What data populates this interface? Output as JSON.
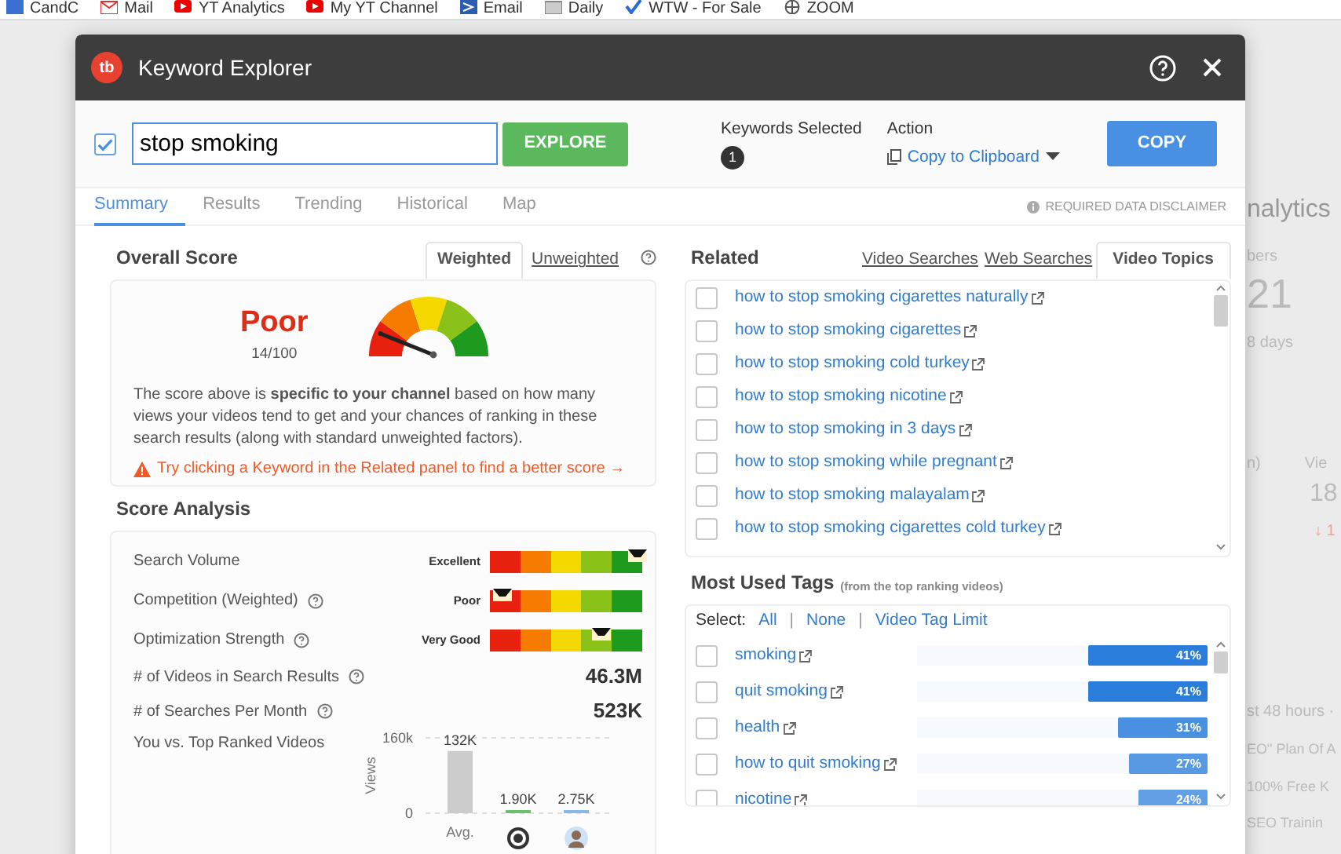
{
  "bookmarks": [
    {
      "label": "CandC",
      "kind": "grid"
    },
    {
      "label": "Mail",
      "kind": "mail"
    },
    {
      "label": "YT Analytics",
      "kind": "play"
    },
    {
      "label": "My YT Channel",
      "kind": "play"
    },
    {
      "label": "Email",
      "kind": "arrow"
    },
    {
      "label": "Daily",
      "kind": "folder"
    },
    {
      "label": "WTW - For Sale",
      "kind": "check"
    },
    {
      "label": "ZOOM",
      "kind": "globe"
    }
  ],
  "background": [
    {
      "kind": "heading",
      "text": "nalytics"
    },
    {
      "kind": "label",
      "text": "bers"
    },
    {
      "kind": "number",
      "text": "21"
    },
    {
      "kind": "label",
      "text": "8 days"
    },
    {
      "kind": "columns",
      "text": "n)",
      "second": "Vie"
    },
    {
      "kind": "number-right",
      "text": "18"
    },
    {
      "kind": "trend",
      "text": "↓ 1"
    },
    {
      "kind": "note",
      "text": "st 48 hours ·"
    },
    {
      "kind": "item",
      "text": "EO\" Plan Of A"
    },
    {
      "kind": "item",
      "text": "100% Free K"
    },
    {
      "kind": "item",
      "text": "SEO Trainin"
    }
  ],
  "dialog": {
    "logo": "tb",
    "title": "Keyword Explorer"
  },
  "search": {
    "checked": true,
    "value": "stop smoking",
    "button": "EXPLORE"
  },
  "keywords_selected": {
    "label": "Keywords Selected",
    "count": "1"
  },
  "action": {
    "label": "Action",
    "value": "Copy to Clipboard",
    "button": "COPY"
  },
  "tabs": [
    {
      "label": "Summary",
      "selected": true
    },
    {
      "label": "Results",
      "selected": false
    },
    {
      "label": "Trending",
      "selected": false
    },
    {
      "label": "Historical",
      "selected": false
    },
    {
      "label": "Map",
      "selected": false
    }
  ],
  "disclaimer": "REQUIRED DATA DISCLAIMER",
  "overall_score": {
    "title": "Overall Score",
    "tabs": [
      {
        "label": "Weighted",
        "selected": true
      },
      {
        "label": "Unweighted",
        "selected": false
      }
    ],
    "rating": "Poor",
    "score": "14/100",
    "gauge": {
      "level": 0.14
    },
    "description": "The score above is **specific to your channel** based on how many views your videos tend to get and your chances of ranking in these search results (along with standard unweighted factors).",
    "tip": "Try clicking a Keyword in the Related panel to find a better score →"
  },
  "score_analysis": {
    "title": "Score Analysis",
    "rows": [
      {
        "kind": "meter",
        "label": "Search Volume",
        "help": false,
        "rating": "Excellent",
        "level": 0.95
      },
      {
        "kind": "meter",
        "label": "Competition (Weighted)",
        "help": true,
        "rating": "Poor",
        "level": 0.06
      },
      {
        "kind": "meter",
        "label": "Optimization Strength",
        "help": true,
        "rating": "Very Good",
        "level": 0.71
      },
      {
        "kind": "stat",
        "label": "# of Videos in Search Results",
        "help": true,
        "value": "46.3M"
      },
      {
        "kind": "stat",
        "label": "# of Searches Per Month",
        "help": true,
        "value": "523K"
      },
      {
        "kind": "chart",
        "label": "You vs. Top Ranked Videos",
        "help": false,
        "bars": [
          {
            "kind": "text",
            "label": "Avg.",
            "color": "#cccccc"
          },
          {
            "kind": "target",
            "color": "#6cc070"
          },
          {
            "kind": "avatar",
            "color": "#8ab8e8"
          }
        ],
        "chart_data": {
          "type": "bar",
          "ylabel": "Views",
          "ylim": [
            0,
            160000
          ],
          "yticks": [
            {
              "value": 0,
              "label": "0"
            },
            {
              "value": 160000,
              "label": "160k"
            }
          ],
          "series": [
            {
              "values": [
                132000,
                1900,
                2750
              ]
            }
          ],
          "value_labels": [
            "132K",
            "1.90K",
            "2.75K"
          ]
        }
      }
    ]
  },
  "related": {
    "title": "Related",
    "tabs": [
      {
        "label": "Video Searches",
        "selected": false
      },
      {
        "label": "Web Searches",
        "selected": false
      },
      {
        "label": "Video Topics",
        "selected": true
      }
    ],
    "items": [
      {
        "label": "how to stop smoking cigarettes naturally",
        "checked": false
      },
      {
        "label": "how to stop smoking cigarettes",
        "checked": false
      },
      {
        "label": "how to stop smoking cold turkey",
        "checked": false
      },
      {
        "label": "how to stop smoking nicotine",
        "checked": false
      },
      {
        "label": "how to stop smoking in 3 days",
        "checked": false
      },
      {
        "label": "how to stop smoking while pregnant",
        "checked": false
      },
      {
        "label": "how to stop smoking malayalam",
        "checked": false
      },
      {
        "label": "how to stop smoking cigarettes cold turkey",
        "checked": false
      }
    ]
  },
  "tags": {
    "title": "Most Used Tags",
    "note": "(from the top ranking videos)",
    "select_label": "Select:",
    "links": [
      "All",
      "None",
      "Video Tag Limit"
    ],
    "separator": "|",
    "items": [
      {
        "label": "smoking",
        "checked": false,
        "level": 0.41,
        "reading": "41%"
      },
      {
        "label": "quit smoking",
        "checked": false,
        "level": 0.41,
        "reading": "41%"
      },
      {
        "label": "health",
        "checked": false,
        "level": 0.31,
        "reading": "31%"
      },
      {
        "label": "how to quit smoking",
        "checked": false,
        "level": 0.27,
        "reading": "27%"
      },
      {
        "label": "nicotine",
        "checked": false,
        "level": 0.24,
        "reading": "24%"
      }
    ]
  }
}
